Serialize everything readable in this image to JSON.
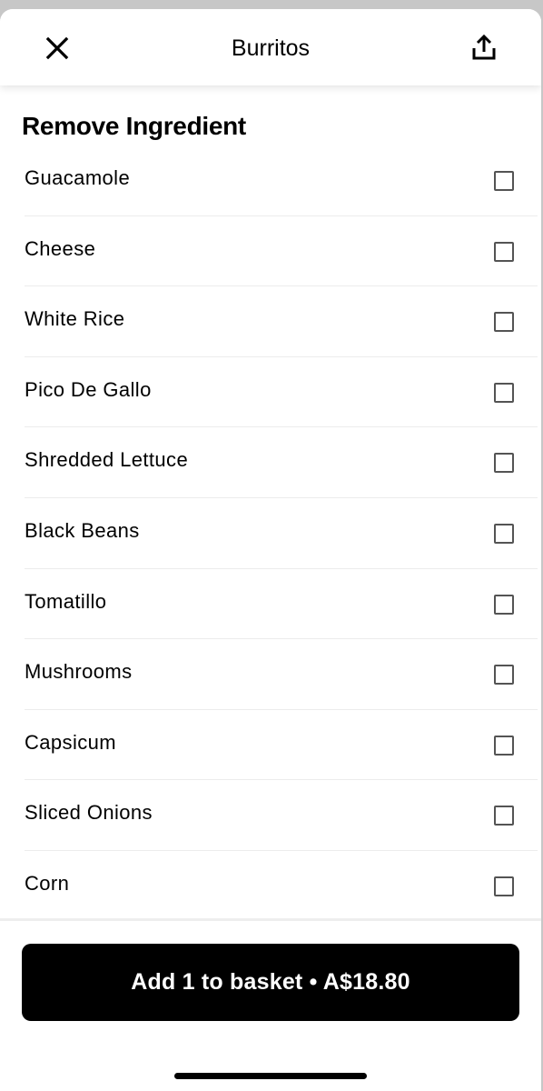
{
  "header": {
    "title": "Burritos",
    "close_icon": "close-icon",
    "share_icon": "share-icon"
  },
  "section": {
    "title": "Remove Ingredient"
  },
  "ingredients": [
    {
      "label": "Guacamole",
      "checked": false
    },
    {
      "label": "Cheese",
      "checked": false
    },
    {
      "label": "White Rice",
      "checked": false
    },
    {
      "label": "Pico De Gallo",
      "checked": false
    },
    {
      "label": "Shredded Lettuce",
      "checked": false
    },
    {
      "label": "Black Beans",
      "checked": false
    },
    {
      "label": "Tomatillo",
      "checked": false
    },
    {
      "label": "Mushrooms",
      "checked": false
    },
    {
      "label": "Capsicum",
      "checked": false
    },
    {
      "label": "Sliced Onions",
      "checked": false
    },
    {
      "label": "Corn",
      "checked": false
    }
  ],
  "cta": {
    "label": "Add 1 to basket • A$18.80"
  },
  "colors": {
    "cta_background": "#000000",
    "checkbox_border": "#545454",
    "divider": "#ececec"
  }
}
